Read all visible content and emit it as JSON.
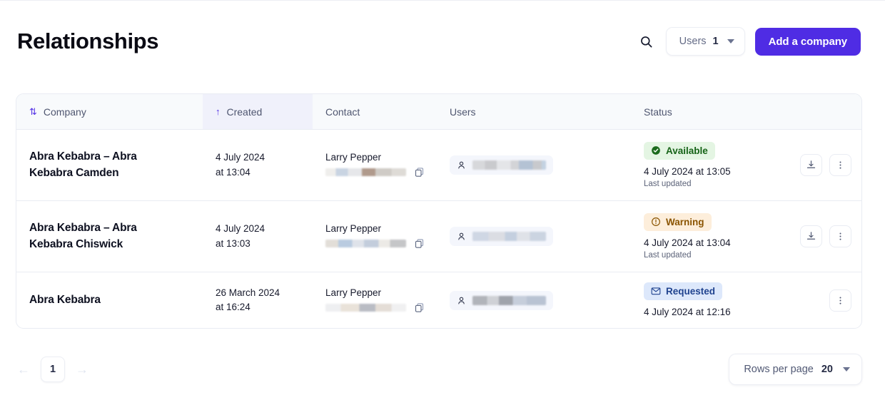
{
  "header": {
    "title": "Relationships",
    "search_icon": "search-icon",
    "users_filter": {
      "label": "Users",
      "value": "1",
      "caret_icon": "chevron-down-icon"
    },
    "add_button": "Add a company",
    "accent_color": "#4f2ce4"
  },
  "table": {
    "columns": [
      {
        "key": "company",
        "label": "Company",
        "sort_icon": "sort-updown-icon",
        "sorted": false
      },
      {
        "key": "created",
        "label": "Created",
        "sort_icon": "sort-up-icon",
        "sorted": true
      },
      {
        "key": "contact",
        "label": "Contact",
        "sorted": false
      },
      {
        "key": "users",
        "label": "Users",
        "sorted": false
      },
      {
        "key": "status",
        "label": "Status",
        "sorted": false
      }
    ],
    "rows": [
      {
        "company": "Abra Kebabra – Abra Kebabra Camden",
        "created_date": "4 July 2024",
        "created_time": "at 13:04",
        "contact_name": "Larry Pepper",
        "contact_email": "[redacted]",
        "copy_icon": "copy-icon",
        "user_chip": {
          "avatar_icon": "person-icon",
          "name": "[redacted]"
        },
        "status": {
          "label": "Available",
          "type": "available",
          "icon": "check-circle-icon"
        },
        "status_time": "4 July 2024 at 13:05",
        "status_caption": "Last updated",
        "actions": [
          "download-icon",
          "more-vertical-icon"
        ]
      },
      {
        "company": "Abra Kebabra – Abra Kebabra Chiswick",
        "created_date": "4 July 2024",
        "created_time": "at 13:03",
        "contact_name": "Larry Pepper",
        "contact_email": "[redacted]",
        "copy_icon": "copy-icon",
        "user_chip": {
          "avatar_icon": "person-icon",
          "name": "[redacted]"
        },
        "status": {
          "label": "Warning",
          "type": "warning",
          "icon": "exclamation-circle-icon"
        },
        "status_time": "4 July 2024 at 13:04",
        "status_caption": "Last updated",
        "actions": [
          "download-icon",
          "more-vertical-icon"
        ]
      },
      {
        "company": "Abra Kebabra",
        "created_date": "26 March 2024",
        "created_time": "at 16:24",
        "contact_name": "Larry Pepper",
        "contact_email": "[redacted]",
        "copy_icon": "copy-icon",
        "user_chip": {
          "avatar_icon": "person-icon",
          "name": "[redacted]"
        },
        "status": {
          "label": "Requested",
          "type": "requested",
          "icon": "envelope-icon"
        },
        "status_time": "4 July 2024 at 12:16",
        "status_caption": "",
        "actions": [
          "more-vertical-icon"
        ]
      }
    ]
  },
  "footer": {
    "prev_arrow": "←",
    "next_arrow": "→",
    "current_page": "1",
    "rows_per_page": {
      "label": "Rows per page",
      "value": "20",
      "caret_icon": "chevron-down-icon"
    }
  },
  "status_colors": {
    "available_bg": "#e4f5e3",
    "available_fg": "#166317",
    "warning_bg": "#fdeedb",
    "warning_fg": "#8a5400",
    "requested_bg": "#dde8fb",
    "requested_fg": "#20438f"
  }
}
